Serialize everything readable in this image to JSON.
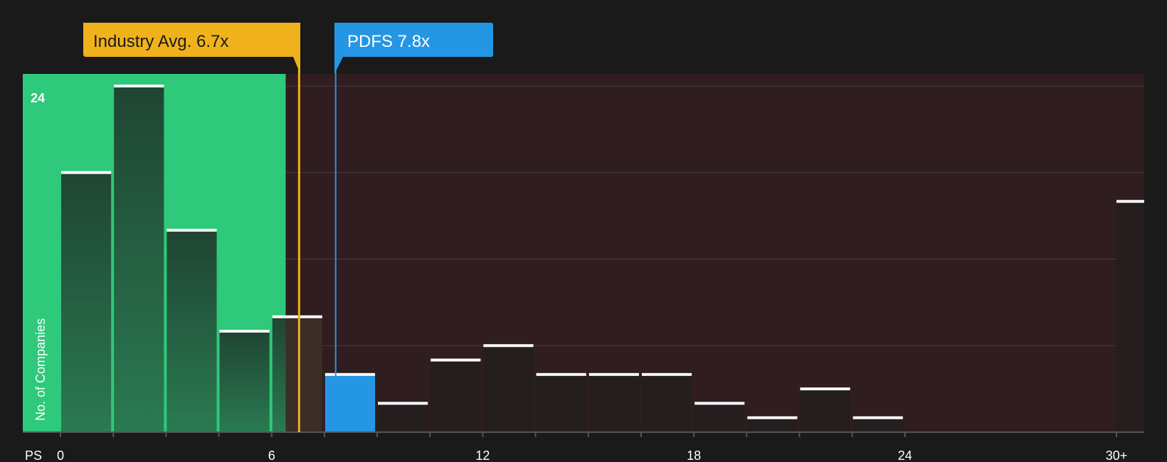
{
  "chart_data": {
    "type": "bar",
    "x_label": "PS",
    "y_label": "No. of Companies",
    "bin_width": 1.5,
    "x_ticks": [
      "0",
      "6",
      "12",
      "18",
      "24",
      "30+"
    ],
    "y_max_label": "24",
    "y_range": [
      0,
      24
    ],
    "bins": [
      {
        "start": 0.0,
        "count": 18
      },
      {
        "start": 1.5,
        "count": 24
      },
      {
        "start": 3.0,
        "count": 14
      },
      {
        "start": 4.5,
        "count": 7
      },
      {
        "start": 6.0,
        "count": 8
      },
      {
        "start": 7.5,
        "count": 4
      },
      {
        "start": 9.0,
        "count": 2
      },
      {
        "start": 10.5,
        "count": 5
      },
      {
        "start": 12.0,
        "count": 6
      },
      {
        "start": 13.5,
        "count": 4
      },
      {
        "start": 15.0,
        "count": 4
      },
      {
        "start": 16.5,
        "count": 4
      },
      {
        "start": 18.0,
        "count": 2
      },
      {
        "start": 19.5,
        "count": 1
      },
      {
        "start": 21.0,
        "count": 3
      },
      {
        "start": 22.5,
        "count": 1
      },
      {
        "start": 30.0,
        "count": 16,
        "label": "30+"
      }
    ],
    "highlight_bin_start": 7.5,
    "industry_avg": {
      "label": "Industry Avg. 6.7x",
      "value": 6.7
    },
    "company": {
      "label": "PDFS 7.8x",
      "value": 7.8
    },
    "fair_zone_max": 6.4,
    "grid": true
  },
  "colors": {
    "background": "#1a1a1a",
    "green_zone": "#2ec97a",
    "red_zone": "#2f1d1f",
    "bar_in_green": "#214b35",
    "bar_in_red": "#241e1e",
    "highlight_bar": "#2596e3",
    "industry_line": "#f0b21c",
    "company_line": "#2596e3",
    "bar_cap": "#ffffff"
  }
}
